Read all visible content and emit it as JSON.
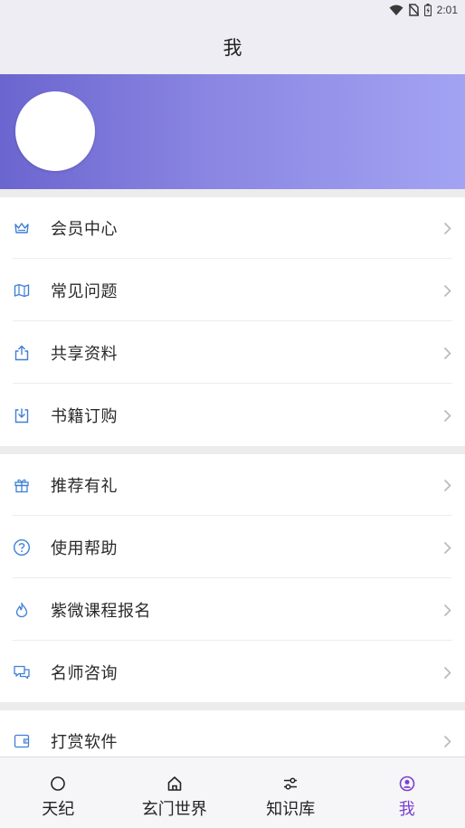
{
  "status_bar": {
    "time": "2:01"
  },
  "header": {
    "title": "我"
  },
  "menu_group_1": [
    {
      "label": "会员中心",
      "icon": "crown-icon"
    },
    {
      "label": "常见问题",
      "icon": "map-icon"
    },
    {
      "label": "共享资料",
      "icon": "share-icon"
    },
    {
      "label": "书籍订购",
      "icon": "download-icon"
    }
  ],
  "menu_group_2": [
    {
      "label": "推荐有礼",
      "icon": "gift-icon"
    },
    {
      "label": "使用帮助",
      "icon": "help-icon"
    },
    {
      "label": "紫微课程报名",
      "icon": "flame-icon"
    },
    {
      "label": "名师咨询",
      "icon": "chat-icon"
    }
  ],
  "menu_group_3": [
    {
      "label": "打赏软件",
      "icon": "wallet-icon"
    }
  ],
  "tabs": [
    {
      "label": "天纪",
      "icon": "circle-icon",
      "active": false
    },
    {
      "label": "玄门世界",
      "icon": "home-icon",
      "active": false
    },
    {
      "label": "知识库",
      "icon": "sliders-icon",
      "active": false
    },
    {
      "label": "我",
      "icon": "user-icon",
      "active": true
    }
  ],
  "colors": {
    "accent": "#7a3fd1",
    "icon_blue": "#3f7fd6",
    "header_start": "#6b65cf",
    "header_end": "#a3a3f3"
  }
}
